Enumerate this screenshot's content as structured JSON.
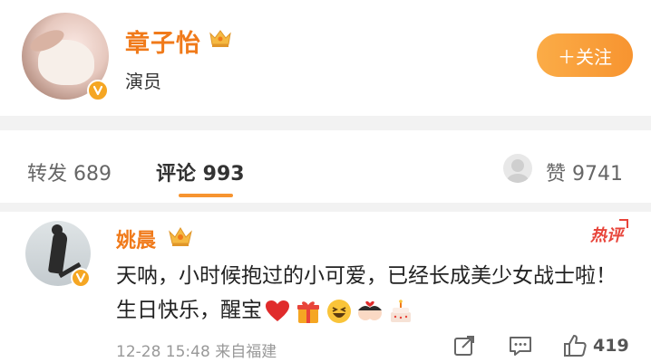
{
  "profile": {
    "name": "章子怡",
    "role": "演员",
    "follow_label": "＋关注"
  },
  "tabs": {
    "repost": "转发 689",
    "comment": "评论 993",
    "likes": "赞 9741"
  },
  "comment": {
    "user_name": "姚晨",
    "hot_badge": "热评",
    "text": "天呐，小时候抱过的小可爱，已经长成美少女战士啦！生日快乐，醒宝",
    "emojis": [
      "heart-icon",
      "gift-icon",
      "laughing-face-icon",
      "couple-face-icon",
      "cake-icon"
    ],
    "time": "12-28 15:48",
    "source": "来自福建",
    "like_count": "419"
  },
  "colors": {
    "accent_orange": "#f07a1a",
    "follow_gradient": "#f79430",
    "hot_red": "#e8443a",
    "verify_badge": "#f5a623",
    "separator": "#f2f2f2"
  }
}
